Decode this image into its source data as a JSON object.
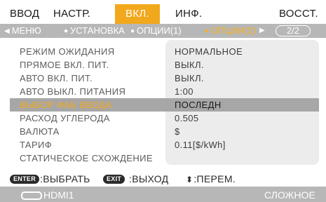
{
  "tabs": [
    {
      "label": "ВВОД",
      "active": false
    },
    {
      "label": "НАСТР.",
      "active": false
    },
    {
      "label": "ВКЛ.",
      "active": true
    },
    {
      "label": "ИНФ.",
      "active": false
    },
    {
      "label": "ВОССТ.",
      "active": false
    }
  ],
  "subtabs": [
    {
      "label": "МЕНЮ",
      "active": false
    },
    {
      "label": "УСТАНОВКА",
      "active": false
    },
    {
      "label": "ОПЦИИ(1)",
      "active": false
    },
    {
      "label": "ОПЦИИ(2)",
      "active": true
    }
  ],
  "page_indicator": "2/2",
  "menu": {
    "items": [
      {
        "label": "РЕЖИМ ОЖИДАНИЯ",
        "value": "НОРМАЛЬНОЕ",
        "selected": false
      },
      {
        "label": "ПРЯМОЕ ВКЛ. ПИТ.",
        "value": "ВЫКЛ.",
        "selected": false
      },
      {
        "label": "АВТО ВКЛ. ПИТ.",
        "value": "ВЫКЛ.",
        "selected": false
      },
      {
        "label": "АВТО ВЫКЛ. ПИТАНИЯ",
        "value": "1:00",
        "selected": false
      },
      {
        "label": "ВЫБОР ФАБ ВВОДА",
        "value": "ПОСЛЕДН",
        "selected": true
      },
      {
        "label": "РАСХОД УГЛЕРОДА",
        "value": "0.505",
        "selected": false
      },
      {
        "label": "ВАЛЮТА",
        "value": "$",
        "selected": false
      },
      {
        "label": "ТАРИФ",
        "value": "0.11[$/kWh]",
        "selected": false
      },
      {
        "label": "СТАТИЧЕСКОЕ СХОЖДЕНИЕ",
        "value": "",
        "selected": false
      }
    ]
  },
  "hints": {
    "enter_key": "ENTER",
    "enter_label": ":ВЫБРАТЬ",
    "exit_key": "EXIT",
    "exit_label": ":ВЫХОД",
    "move_icon": "updown-arrow-icon",
    "move_label": ":ПЕРЕМ."
  },
  "status": {
    "source_icon": "hdmi-connector-icon",
    "source": "HDMI1",
    "mode": "СЛОЖНОЕ"
  },
  "colors": {
    "accent": "#f2a81c",
    "bar": "#b7b7b7",
    "selected_row": "#a7a7a7",
    "value_box": "#ececec"
  }
}
